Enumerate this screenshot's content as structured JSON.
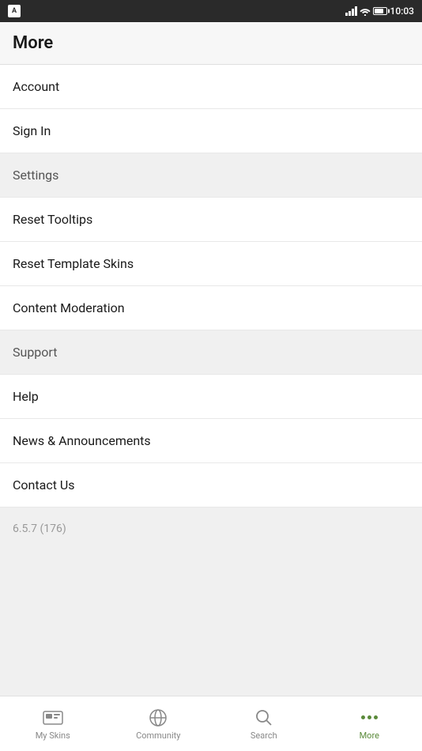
{
  "statusBar": {
    "time": "10:03",
    "appIconLabel": "A"
  },
  "pageTitle": "More",
  "menuItems": [
    {
      "id": "account",
      "label": "Account",
      "section": false
    },
    {
      "id": "sign-in",
      "label": "Sign In",
      "section": false
    },
    {
      "id": "settings",
      "label": "Settings",
      "section": true
    },
    {
      "id": "reset-tooltips",
      "label": "Reset Tooltips",
      "section": false
    },
    {
      "id": "reset-template-skins",
      "label": "Reset Template Skins",
      "section": false
    },
    {
      "id": "content-moderation",
      "label": "Content Moderation",
      "section": false
    },
    {
      "id": "support",
      "label": "Support",
      "section": true
    },
    {
      "id": "help",
      "label": "Help",
      "section": false
    },
    {
      "id": "news-announcements",
      "label": "News & Announcements",
      "section": false
    },
    {
      "id": "contact-us",
      "label": "Contact Us",
      "section": false
    }
  ],
  "version": "6.5.7 (176)",
  "bottomNav": {
    "items": [
      {
        "id": "my-skins",
        "label": "My Skins",
        "active": false,
        "icon": "skins-icon"
      },
      {
        "id": "community",
        "label": "Community",
        "active": false,
        "icon": "globe-icon"
      },
      {
        "id": "search",
        "label": "Search",
        "active": false,
        "icon": "search-icon"
      },
      {
        "id": "more",
        "label": "More",
        "active": true,
        "icon": "more-icon"
      }
    ]
  }
}
